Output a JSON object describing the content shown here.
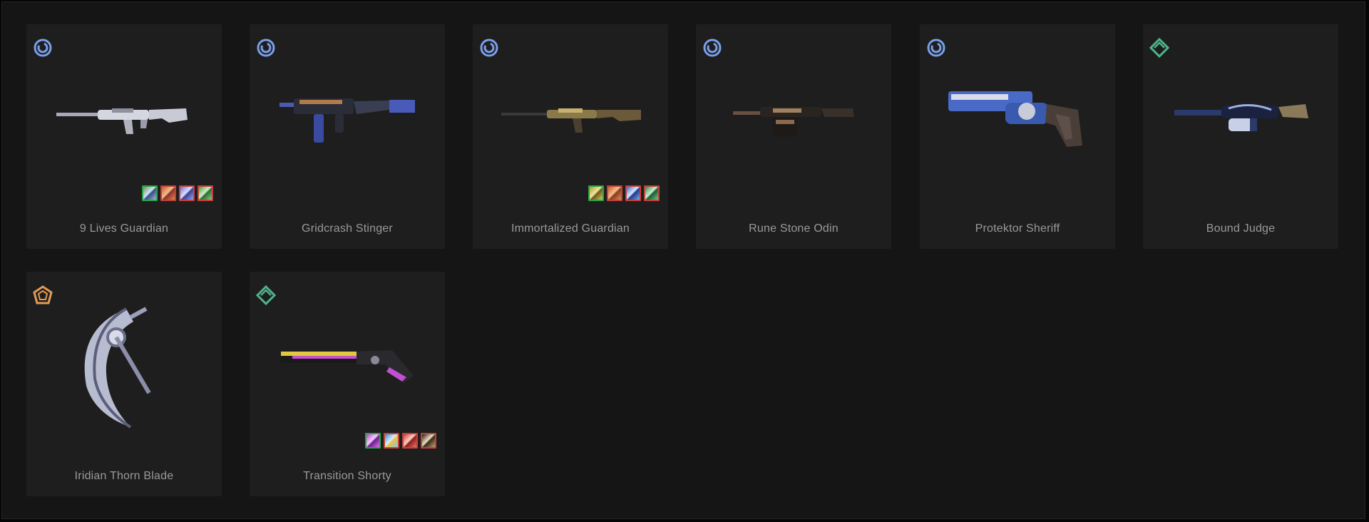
{
  "skins": [
    {
      "name": "9 Lives Guardian",
      "tier": "select-tier-icon",
      "tier_color": "#7a9ee8",
      "chromas": [
        {
          "border": "#2ca34a",
          "fill": "linear-gradient(135deg,#6b8f5a 0%,#cfe6f0 45%,#3a4a8a 55%,#9fb7d8 100%)"
        },
        {
          "border": "#c4413b",
          "fill": "linear-gradient(135deg,#c95a2a 0%,#f1c089 45%,#8a2f2f 55%,#e08a4a 100%)"
        },
        {
          "border": "#c4413b",
          "fill": "linear-gradient(135deg,#6a6fd0 0%,#dbe3ff 45%,#3a3f9a 55%,#9aa5f0 100%)"
        },
        {
          "border": "#c4413b",
          "fill": "linear-gradient(135deg,#4f9a4a 0%,#d3f0c6 45%,#2f6a3a 55%,#8ccd7a 100%)"
        }
      ]
    },
    {
      "name": "Gridcrash Stinger",
      "tier": "select-tier-icon",
      "tier_color": "#7a9ee8",
      "chromas": []
    },
    {
      "name": "Immortalized Guardian",
      "tier": "select-tier-icon",
      "tier_color": "#7a9ee8",
      "chromas": [
        {
          "border": "#2ca34a",
          "fill": "linear-gradient(135deg,#a89a2a 0%,#f2e8a0 45%,#6a5a1a 55%,#d8c860 100%)"
        },
        {
          "border": "#c4413b",
          "fill": "linear-gradient(135deg,#c8602a 0%,#f4c090 45%,#8a3a1f 55%,#e08a50 100%)"
        },
        {
          "border": "#c4413b",
          "fill": "linear-gradient(135deg,#3a6ad0 0%,#d8e8ff 45%,#1f3a8a 55%,#80a8f0 100%)"
        },
        {
          "border": "#c4413b",
          "fill": "linear-gradient(135deg,#2f8a4a 0%,#c8f0d0 45%,#1f5a30 55%,#70c890 100%)"
        }
      ]
    },
    {
      "name": "Rune Stone Odin",
      "tier": "select-tier-icon",
      "tier_color": "#7a9ee8",
      "chromas": []
    },
    {
      "name": "Protektor Sheriff",
      "tier": "select-tier-icon",
      "tier_color": "#7a9ee8",
      "chromas": []
    },
    {
      "name": "Bound Judge",
      "tier": "deluxe-tier-icon",
      "tier_color": "#4fb38c",
      "chromas": []
    },
    {
      "name": "Iridian Thorn Blade",
      "tier": "exclusive-tier-icon",
      "tier_color": "#e39a54",
      "chromas": []
    },
    {
      "name": "Transition Shorty",
      "tier": "deluxe-tier-icon",
      "tier_color": "#4fb38c",
      "chromas": [
        {
          "border": "#2ca34a",
          "fill": "linear-gradient(135deg,#c23ad0 0%,#f4d0ff 45%,#6a1f8a 55%,#e070f0 100%)"
        },
        {
          "border": "#c4413b",
          "fill": "linear-gradient(135deg,#3a8ad0 0%,#d8f0ff 45%,#f0c040 55%,#80c8f0 100%)"
        },
        {
          "border": "#c4413b",
          "fill": "linear-gradient(135deg,#c83a3a 0%,#ffd0c0 45%,#8a1f1f 55%,#f07060 100%)"
        },
        {
          "border": "#c4413b",
          "fill": "linear-gradient(135deg,#1f1f1f 0%,#f0e0c0 45%,#3a2a1a 55%,#c0a070 100%)"
        }
      ]
    }
  ]
}
